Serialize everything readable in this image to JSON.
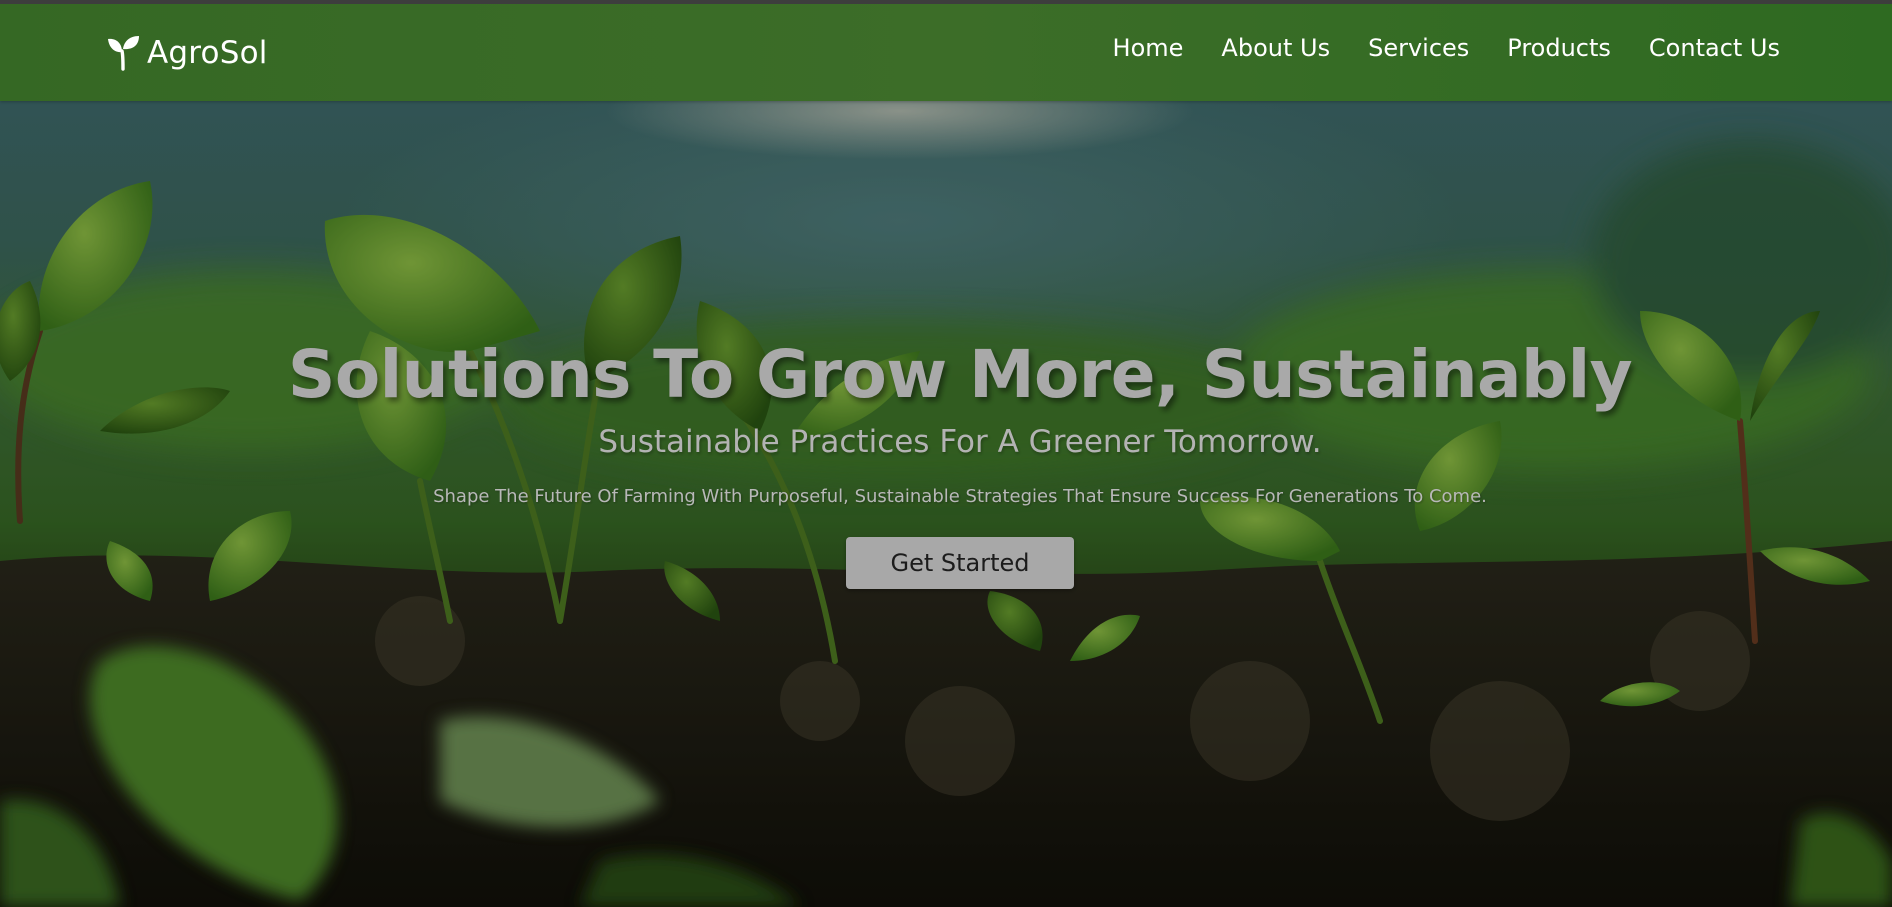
{
  "navbar": {
    "brand_icon": "sprout-icon",
    "brand_name": "AgroSol",
    "links": [
      {
        "label": "Home"
      },
      {
        "label": "About Us"
      },
      {
        "label": "Services"
      },
      {
        "label": "Products"
      },
      {
        "label": "Contact Us"
      }
    ]
  },
  "hero": {
    "title": "Solutions To Grow More, Sustainably",
    "subtitle": "Sustainable Practices For A Greener Tomorrow.",
    "description": "Shape The Future Of Farming With Purposeful, Sustainable Strategies That Ensure Success For Generations To Come.",
    "cta_label": "Get Started"
  },
  "colors": {
    "navbar_green": "#3c6d28",
    "cta_background": "#a8a8a8",
    "hero_text": "#a9a9a9"
  }
}
